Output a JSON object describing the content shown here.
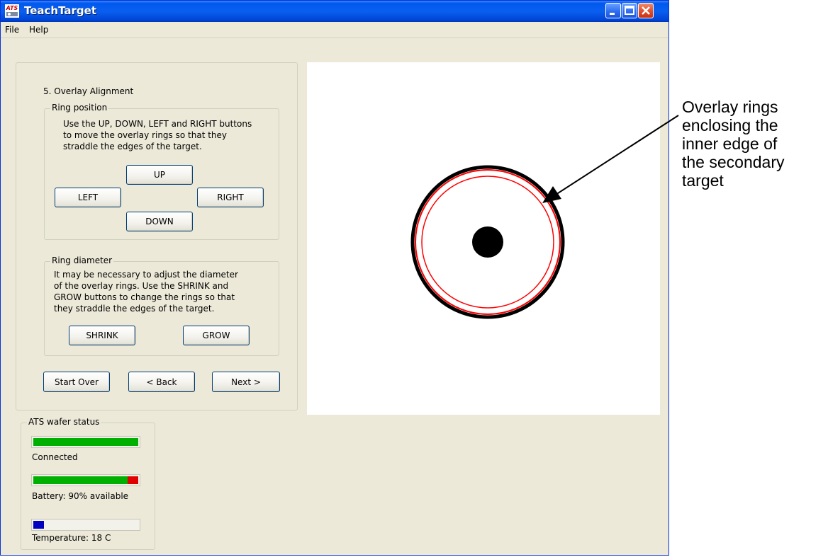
{
  "window": {
    "title": "TeachTarget",
    "icon_name": "ats-app-icon",
    "icon_label": "ATS"
  },
  "menu": {
    "items": [
      "File",
      "Help"
    ]
  },
  "wizard": {
    "step_title": "5. Overlay Alignment",
    "ring_position": {
      "legend": "Ring position",
      "lines": [
        "Use the UP, DOWN, LEFT and RIGHT buttons",
        "to move the overlay rings so that they",
        "straddle the edges of the target."
      ],
      "buttons": {
        "up": "UP",
        "left": "LEFT",
        "right": "RIGHT",
        "down": "DOWN"
      }
    },
    "ring_diameter": {
      "legend": "Ring diameter",
      "lines": [
        "It may be necessary to adjust the diameter",
        "of the overlay rings.  Use the SHRINK and",
        "GROW buttons to change the rings so that",
        "they straddle the edges of the target."
      ],
      "buttons": {
        "shrink": "SHRINK",
        "grow": "GROW"
      }
    },
    "nav": {
      "start_over": "Start Over",
      "back": "< Back",
      "next": "Next >"
    }
  },
  "status": {
    "legend": "ATS wafer status",
    "connected": {
      "label": "Connected",
      "fraction": 1.0,
      "color": "#00B000"
    },
    "battery": {
      "label": "Battery: 90% available",
      "fraction": 0.9,
      "color": "#00B000",
      "empty_color": "#E00000"
    },
    "temperature": {
      "label": "Temperature: 18 C",
      "fraction": 0.1,
      "color": "#0000C0"
    }
  },
  "colors": {
    "target": "#000000",
    "overlay_ring": "#FF0000"
  },
  "annotation": {
    "lines": [
      "Overlay rings",
      "enclosing the",
      "inner edge of",
      "the secondary",
      "target"
    ]
  }
}
